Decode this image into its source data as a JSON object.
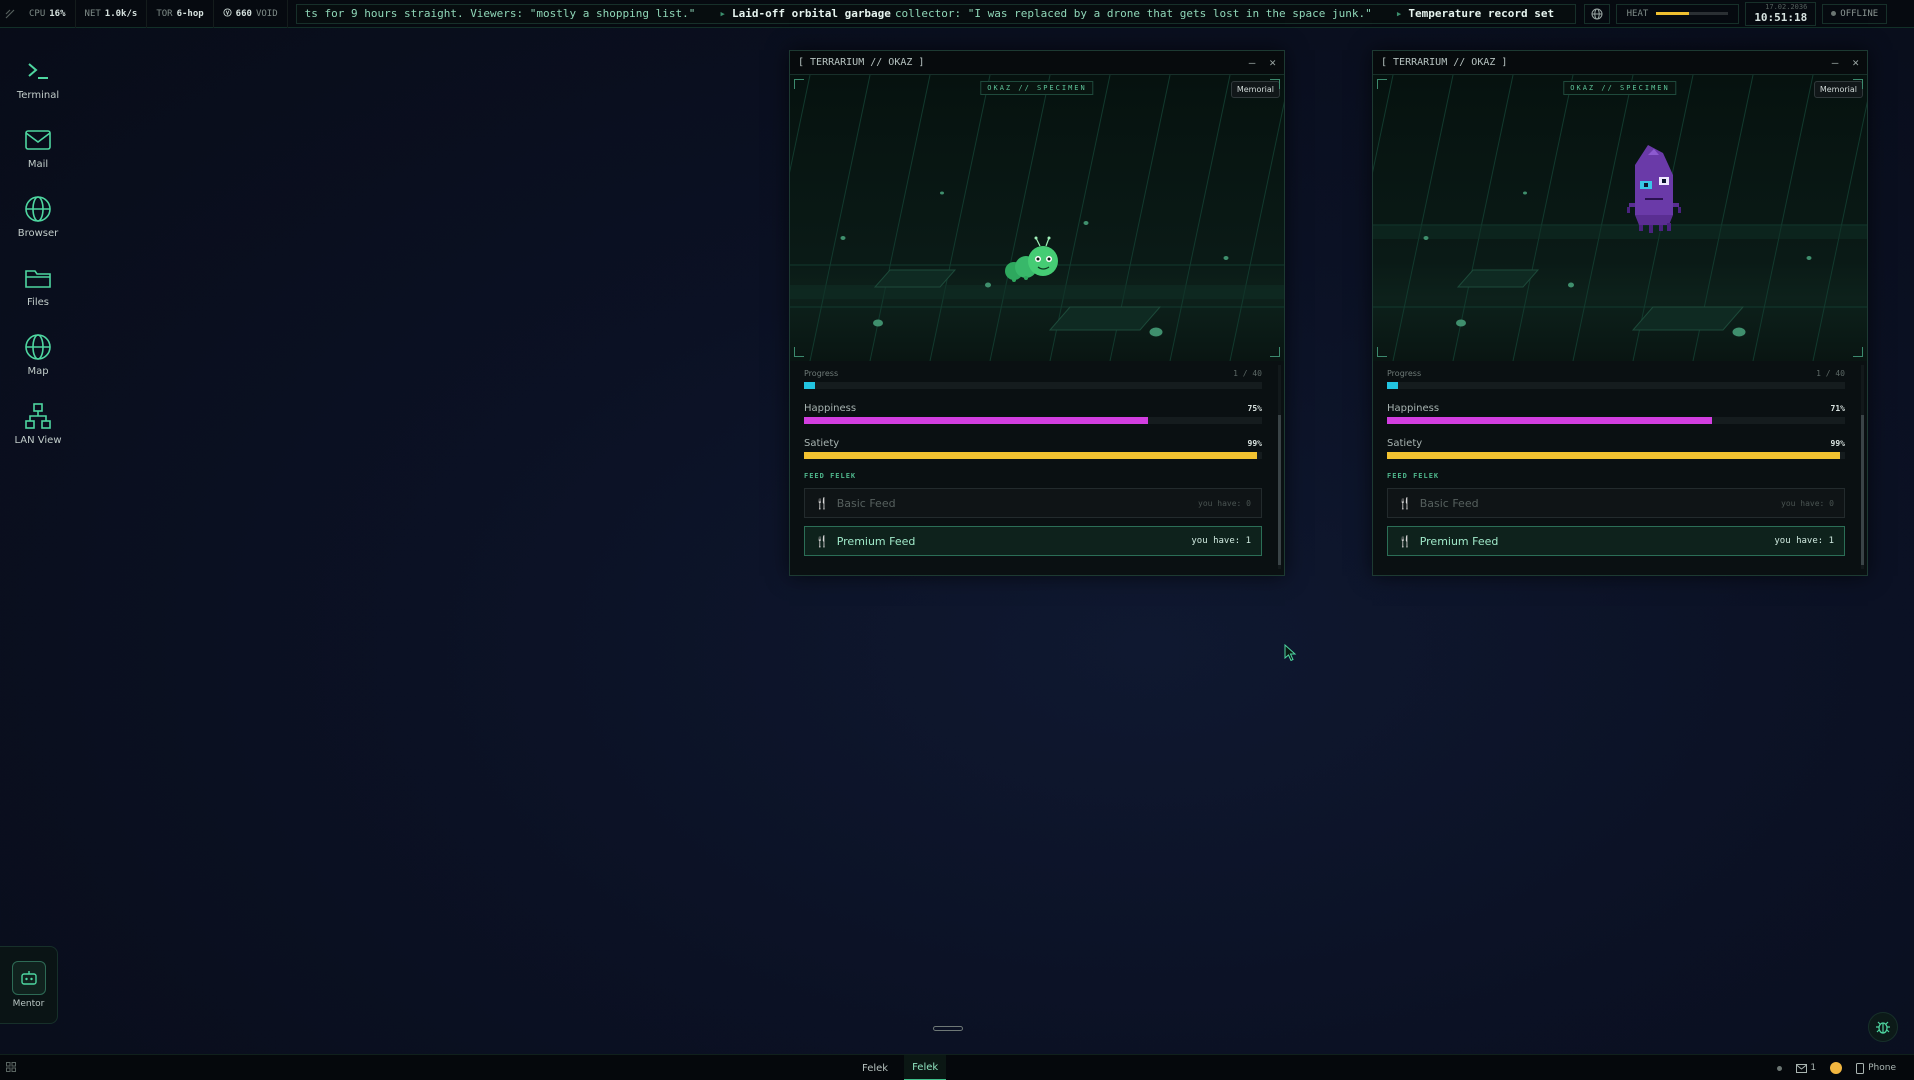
{
  "topbar": {
    "cpu_label": "CPU",
    "cpu_value": "16%",
    "net_label": "NET",
    "net_value": "1.0k/s",
    "tor_label": "TOR",
    "tor_value": "6-hop",
    "void_value": "660",
    "void_label": "VOID",
    "ticker": {
      "part1": "ts for 9 hours straight. Viewers: \"mostly a shopping list.\"",
      "head2": "Laid-off orbital garbage",
      "part2": "collector: \"I was replaced by a drone that gets lost in the space junk.\"",
      "head3": "Temperature record set"
    },
    "heat_label": "HEAT",
    "heat_level": 0.45,
    "date": "17.02.2036",
    "time": "10:51:18",
    "status": "OFFLINE"
  },
  "desktop": {
    "icons": [
      {
        "label": "Terminal",
        "icon": "terminal-icon"
      },
      {
        "label": "Mail",
        "icon": "mail-icon"
      },
      {
        "label": "Browser",
        "icon": "globe-icon"
      },
      {
        "label": "Files",
        "icon": "folder-icon"
      },
      {
        "label": "Map",
        "icon": "globe-icon"
      },
      {
        "label": "LAN View",
        "icon": "network-icon"
      }
    ],
    "mentor_label": "Mentor"
  },
  "windows": [
    {
      "title": "[ TERRARIUM // OKAZ ]",
      "specimen_label": "OKAZ // SPECIMEN",
      "memorial_label": "Memorial",
      "creature": "green-caterpillar",
      "progress_label": "Progress",
      "progress_value": "1 / 40",
      "progress_fraction": 0.025,
      "happiness_label": "Happiness",
      "happiness_value": "75%",
      "happiness_fraction": 0.75,
      "satiety_label": "Satiety",
      "satiety_value": "99%",
      "satiety_fraction": 0.99,
      "feed_section": "FEED FELEK",
      "basic_feed_label": "Basic Feed",
      "basic_feed_have": "you have: 0",
      "premium_feed_label": "Premium Feed",
      "premium_feed_have": "you have: 1"
    },
    {
      "title": "[ TERRARIUM // OKAZ ]",
      "specimen_label": "OKAZ // SPECIMEN",
      "memorial_label": "Memorial",
      "creature": "purple-blob",
      "progress_label": "Progress",
      "progress_value": "1 / 40",
      "progress_fraction": 0.025,
      "happiness_label": "Happiness",
      "happiness_value": "71%",
      "happiness_fraction": 0.71,
      "satiety_label": "Satiety",
      "satiety_value": "99%",
      "satiety_fraction": 0.99,
      "feed_section": "FEED FELEK",
      "basic_feed_label": "Basic Feed",
      "basic_feed_have": "you have: 0",
      "premium_feed_label": "Premium Feed",
      "premium_feed_have": "you have: 1"
    }
  ],
  "colors": {
    "progress": "#22c4e0",
    "happiness": "#d23ee0",
    "satiety": "#f2c230",
    "accent": "#3ec08a"
  },
  "taskbar": {
    "tasks": [
      "Felek",
      "Felek"
    ],
    "mail_count": "1",
    "phone_label": "Phone"
  }
}
